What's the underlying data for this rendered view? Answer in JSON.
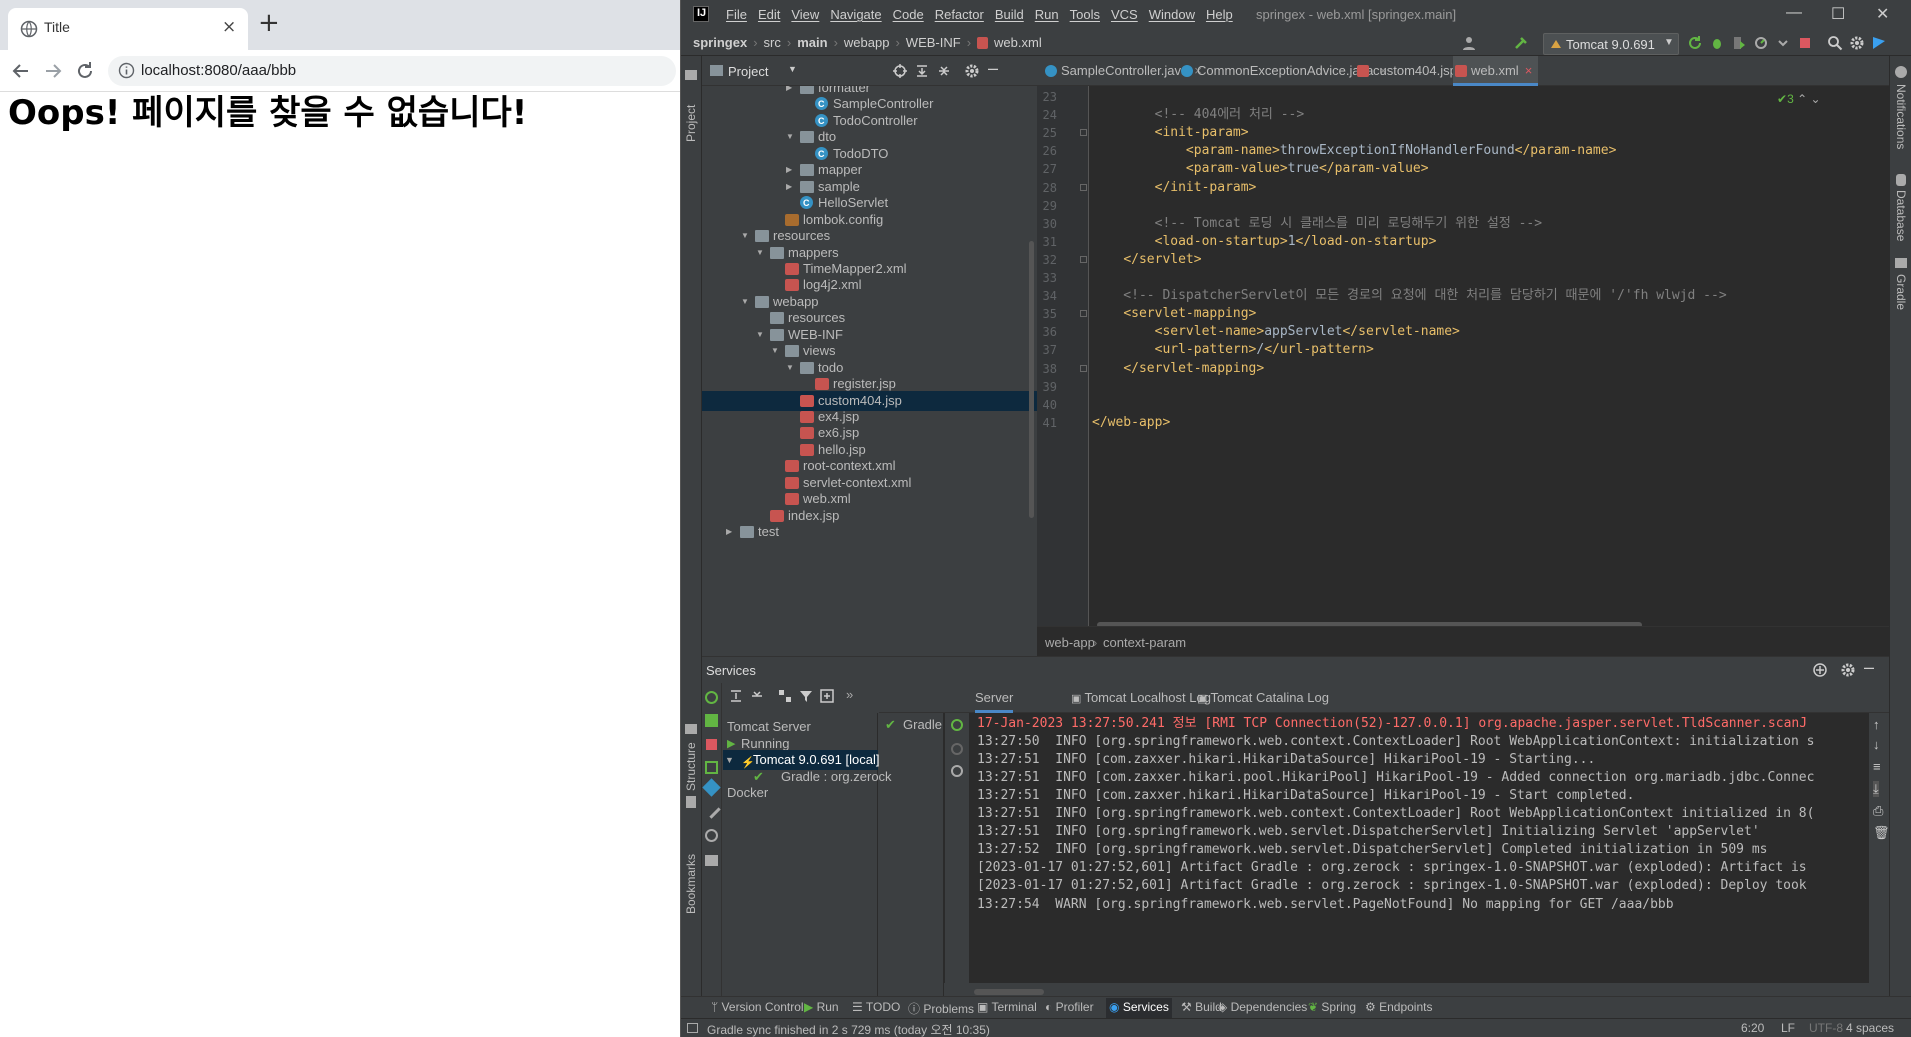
{
  "browser": {
    "tab_title": "Title",
    "url": "localhost:8080/aaa/bbb",
    "heading": "Oops! 페이지를 찾을 수 없습니다!"
  },
  "ide": {
    "menus": [
      "File",
      "Edit",
      "View",
      "Navigate",
      "Code",
      "Refactor",
      "Build",
      "Run",
      "Tools",
      "VCS",
      "Window",
      "Help"
    ],
    "window_title": "springex - web.xml [springex.main]",
    "breadcrumbs": [
      "springex",
      "src",
      "main",
      "webapp",
      "WEB-INF",
      "web.xml"
    ],
    "run_config": "Tomcat 9.0.691",
    "project_label": "Project",
    "tree": [
      {
        "label": "formatter",
        "type": "folder",
        "arrow": ">"
      },
      {
        "label": "SampleController",
        "type": "class",
        "arrow": ""
      },
      {
        "label": "TodoController",
        "type": "class",
        "arrow": ""
      },
      {
        "label": "dto",
        "type": "folder",
        "arrow": "v"
      },
      {
        "label": "TodoDTO",
        "type": "class",
        "arrow": ""
      },
      {
        "label": "mapper",
        "type": "folder",
        "arrow": ">"
      },
      {
        "label": "sample",
        "type": "folder",
        "arrow": ">"
      },
      {
        "label": "HelloServlet",
        "type": "class",
        "arrow": ""
      },
      {
        "label": "lombok.config",
        "type": "config",
        "arrow": ""
      },
      {
        "label": "resources",
        "type": "folder",
        "arrow": "v"
      },
      {
        "label": "mappers",
        "type": "folder",
        "arrow": "v"
      },
      {
        "label": "TimeMapper2.xml",
        "type": "xml",
        "arrow": ""
      },
      {
        "label": "log4j2.xml",
        "type": "xml",
        "arrow": ""
      },
      {
        "label": "webapp",
        "type": "folder",
        "arrow": "v"
      },
      {
        "label": "resources",
        "type": "folder",
        "arrow": ""
      },
      {
        "label": "WEB-INF",
        "type": "folder",
        "arrow": "v"
      },
      {
        "label": "views",
        "type": "folder",
        "arrow": "v"
      },
      {
        "label": "todo",
        "type": "folder",
        "arrow": "v"
      },
      {
        "label": "register.jsp",
        "type": "jsp",
        "arrow": ""
      },
      {
        "label": "custom404.jsp",
        "type": "jsp",
        "arrow": "",
        "selected": true
      },
      {
        "label": "ex4.jsp",
        "type": "jsp",
        "arrow": ""
      },
      {
        "label": "ex6.jsp",
        "type": "jsp",
        "arrow": ""
      },
      {
        "label": "hello.jsp",
        "type": "jsp",
        "arrow": ""
      },
      {
        "label": "root-context.xml",
        "type": "xml",
        "arrow": ""
      },
      {
        "label": "servlet-context.xml",
        "type": "xml",
        "arrow": ""
      },
      {
        "label": "web.xml",
        "type": "xml",
        "arrow": ""
      },
      {
        "label": "index.jsp",
        "type": "jsp",
        "arrow": ""
      },
      {
        "label": "test",
        "type": "folder",
        "arrow": ">"
      }
    ],
    "editor_tabs": [
      "SampleController.java",
      "CommonExceptionAdvice.java",
      "custom404.jsp",
      "web.xml"
    ],
    "inspection_count": "3",
    "code_lines": [
      {
        "n": "23",
        "t": ""
      },
      {
        "n": "24",
        "t": "        <!-- 404에러 처리 -->"
      },
      {
        "n": "25",
        "t": "        <init-param>"
      },
      {
        "n": "26",
        "t": "            <param-name>throwExceptionIfNoHandlerFound</param-name>"
      },
      {
        "n": "27",
        "t": "            <param-value>true</param-value>"
      },
      {
        "n": "28",
        "t": "        </init-param>"
      },
      {
        "n": "29",
        "t": ""
      },
      {
        "n": "30",
        "t": "        <!-- Tomcat 로딩 시 클래스를 미리 로딩해두기 위한 설정 -->"
      },
      {
        "n": "31",
        "t": "        <load-on-startup>1</load-on-startup>"
      },
      {
        "n": "32",
        "t": "    </servlet>"
      },
      {
        "n": "33",
        "t": ""
      },
      {
        "n": "34",
        "t": "    <!-- DispatcherServlet이 모든 경로의 요청에 대한 처리를 담당하기 때문에 '/'fh wlwjd -->"
      },
      {
        "n": "35",
        "t": "    <servlet-mapping>"
      },
      {
        "n": "36",
        "t": "        <servlet-name>appServlet</servlet-name>"
      },
      {
        "n": "37",
        "t": "        <url-pattern>/</url-pattern>"
      },
      {
        "n": "38",
        "t": "    </servlet-mapping>"
      },
      {
        "n": "39",
        "t": ""
      },
      {
        "n": "40",
        "t": ""
      },
      {
        "n": "41",
        "t": "</web-app>"
      }
    ],
    "editor_breadcrumb": [
      "web-app",
      "context-param"
    ],
    "services": {
      "title": "Services",
      "tree": [
        "Tomcat Server",
        "Running",
        "Tomcat 9.0.691 [local]",
        "Gradle : org.zerock",
        "Docker"
      ],
      "mid_label": "Gradle : or",
      "tabs": [
        "Server",
        "Tomcat Localhost Log",
        "Tomcat Catalina Log"
      ],
      "log": [
        "17-Jan-2023 13:27:50.241 정보 [RMI TCP Connection(52)-127.0.0.1] org.apache.jasper.servlet.TldScanner.scanJ",
        "13:27:50  INFO [org.springframework.web.context.ContextLoader] Root WebApplicationContext: initialization s",
        "13:27:51  INFO [com.zaxxer.hikari.HikariDataSource] HikariPool-19 - Starting...",
        "13:27:51  INFO [com.zaxxer.hikari.pool.HikariPool] HikariPool-19 - Added connection org.mariadb.jdbc.Connec",
        "13:27:51  INFO [com.zaxxer.hikari.HikariDataSource] HikariPool-19 - Start completed.",
        "13:27:51  INFO [org.springframework.web.context.ContextLoader] Root WebApplicationContext initialized in 8(",
        "13:27:51  INFO [org.springframework.web.servlet.DispatcherServlet] Initializing Servlet 'appServlet'",
        "13:27:52  INFO [org.springframework.web.servlet.DispatcherServlet] Completed initialization in 509 ms",
        "[2023-01-17 01:27:52,601] Artifact Gradle : org.zerock : springex-1.0-SNAPSHOT.war (exploded): Artifact is",
        "[2023-01-17 01:27:52,601] Artifact Gradle : org.zerock : springex-1.0-SNAPSHOT.war (exploded): Deploy took",
        "13:27:54  WARN [org.springframework.web.servlet.PageNotFound] No mapping for GET /aaa/bbb"
      ]
    },
    "bottom_tools": [
      "Version Control",
      "Run",
      "TODO",
      "Problems",
      "Terminal",
      "Profiler",
      "Services",
      "Build",
      "Dependencies",
      "Spring",
      "Endpoints"
    ],
    "left_strip": [
      "Project",
      "Structure",
      "Bookmarks"
    ],
    "right_strip": [
      "Notifications",
      "Database",
      "Gradle"
    ],
    "status": {
      "message": "Gradle sync finished in 2 s 729 ms (today 오전 10:35)",
      "position": "6:20",
      "line_sep": "LF",
      "encoding": "UTF-8",
      "indent": "4 spaces"
    }
  }
}
